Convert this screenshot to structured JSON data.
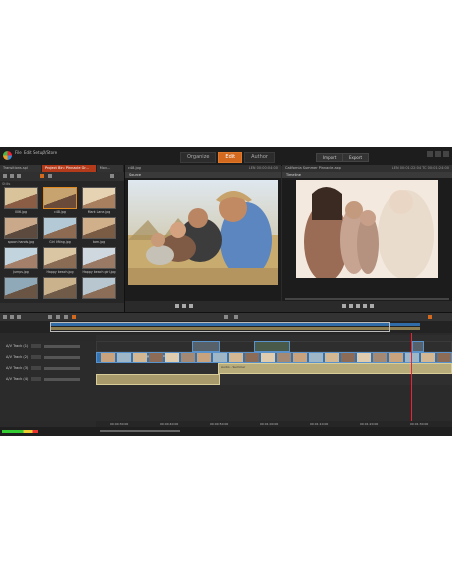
{
  "menu": {
    "items": [
      "File",
      "Edit",
      "Setup",
      "?/Store"
    ]
  },
  "modes": [
    "Organize",
    "Edit",
    "Author"
  ],
  "active_mode": "Edit",
  "top_buttons": [
    "Import",
    "Export"
  ],
  "library": {
    "tabs": [
      "Transitions.spl",
      "Project Bin: Pinnacle Gr...",
      "Mov..."
    ],
    "section": "Stills",
    "thumbs": [
      {
        "caption": "006.jpg"
      },
      {
        "caption": "c48.jpg"
      },
      {
        "caption": "Mark Lane.jpg"
      },
      {
        "caption": "spoon hands.jpg"
      },
      {
        "caption": "Girl lifting.jpg"
      },
      {
        "caption": "tom.jpg"
      },
      {
        "caption": "Jumps.jpg"
      },
      {
        "caption": "Happy beach.jpg"
      },
      {
        "caption": "Happy beach girl.jpg"
      },
      {
        "caption": ""
      },
      {
        "caption": ""
      },
      {
        "caption": ""
      }
    ]
  },
  "source": {
    "file": "c48.jpg",
    "label": "Source",
    "timecode": "LEN 00:00:04:00"
  },
  "preview": {
    "file": "California Summer Pinnacle.axp",
    "label": "Timeline",
    "timecode": "LEN 00:01:22:04 TC 00:01:24:00"
  },
  "tracks": [
    {
      "name": "A/V Track (1)"
    },
    {
      "name": "A/V Track (2)"
    },
    {
      "name": "A/V Track (3)"
    },
    {
      "name": "A/V Track (4)"
    }
  ],
  "clips": {
    "title_clip": "Nothing but summer",
    "audio_clip": "Audio - Summer"
  },
  "timecodes": [
    "00:00:30:00",
    "00:00:40:00",
    "00:00:50:00",
    "00:01:00:00",
    "00:01:10:00",
    "00:01:20:00",
    "00:01:30:00"
  ],
  "colors": {
    "accent": "#d2691e",
    "clip_blue": "#3574b3",
    "audio": "#b8ac7a",
    "playhead": "#ee2233"
  }
}
